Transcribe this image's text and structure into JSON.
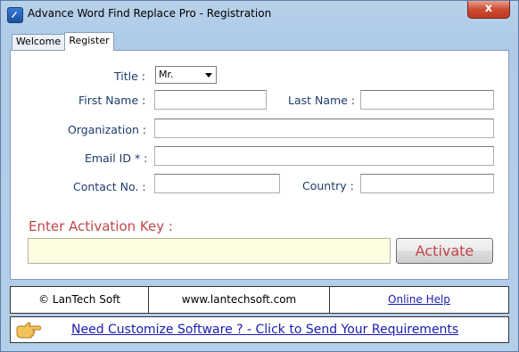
{
  "window": {
    "title": "Advance Word Find Replace Pro  - Registration",
    "close_label": "x"
  },
  "tabs": [
    {
      "label": "Welcome",
      "active": false
    },
    {
      "label": "Register",
      "active": true
    }
  ],
  "form": {
    "title_label": "Title :",
    "title_value": "Mr.",
    "first_name_label": "First Name :",
    "first_name_value": "",
    "last_name_label": "Last Name :",
    "last_name_value": "",
    "organization_label": "Organization :",
    "organization_value": "",
    "email_label": "Email ID * :",
    "email_value": "",
    "contact_label": "Contact No. :",
    "contact_value": "",
    "country_label": "Country :",
    "country_value": ""
  },
  "activation": {
    "label": "Enter Activation Key  :",
    "value": "",
    "button_label": "Activate"
  },
  "footer": {
    "copyright": "© LanTech Soft",
    "website": "www.lantechsoft.com",
    "help_link": "Online Help"
  },
  "banner": {
    "text": "Need Customize Software ? - Click to Send Your Requirements",
    "icon": "pointing-hand-icon"
  },
  "colors": {
    "accent_red": "#c0464b",
    "label_blue": "#1e3c6e",
    "link_blue": "#1a1ab0",
    "activation_bg": "#fdfce0"
  }
}
